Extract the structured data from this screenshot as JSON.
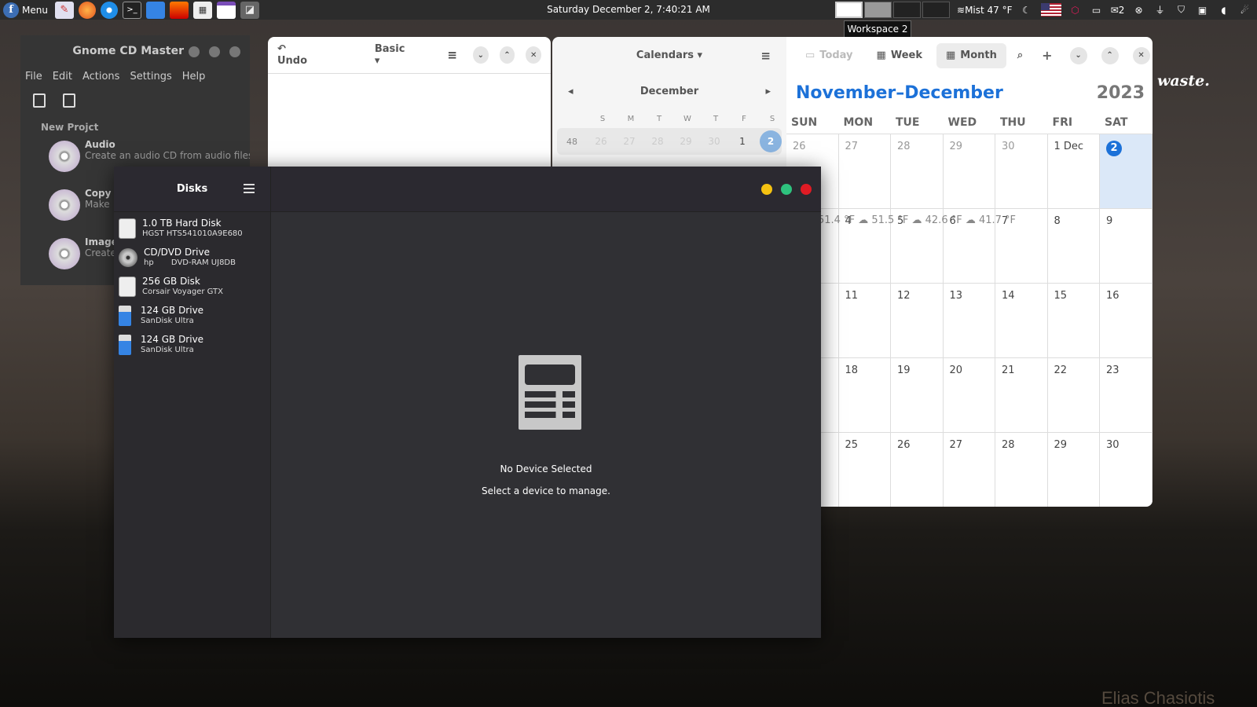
{
  "panel": {
    "menu_label": "Menu",
    "clock": "Saturday December  2,   7:40:21 AM",
    "weather": "Mist 47 °F",
    "notifications_count": "2",
    "workspace_tooltip": "Workspace 2",
    "launchers": [
      "text-editor-icon",
      "firefox-icon",
      "thunderbird-icon",
      "terminal-icon",
      "files-icon",
      "red-app-icon",
      "calculator-icon",
      "calendar-icon",
      "screenshot-icon"
    ]
  },
  "cdmaster": {
    "title": "Gnome CD Master",
    "menu": [
      "File",
      "Edit",
      "Actions",
      "Settings",
      "Help"
    ],
    "section": "New Projct",
    "items": [
      {
        "name": "Audio",
        "desc": "Create an audio CD from audio files"
      },
      {
        "name": "Copy",
        "desc": "Make"
      },
      {
        "name": "Image",
        "desc": "Create"
      }
    ]
  },
  "calculator": {
    "undo_label": "Undo",
    "mode_label": "Basic"
  },
  "calendar_sidebar": {
    "calendars_label": "Calendars",
    "month": "December",
    "dows": [
      "S",
      "M",
      "T",
      "W",
      "T",
      "F",
      "S"
    ],
    "week_number": "48",
    "week_days": [
      "26",
      "27",
      "28",
      "29",
      "30",
      "1",
      "2"
    ]
  },
  "calendar_main": {
    "today_label": "Today",
    "week_label": "Week",
    "month_label": "Month",
    "range_title": "November–December",
    "year": "2023",
    "dows": [
      "SUN",
      "MON",
      "TUE",
      "WED",
      "THU",
      "FRI",
      "SAT"
    ],
    "weeks": [
      [
        "26",
        "27",
        "28",
        "29",
        "30",
        "1  Dec",
        "2"
      ],
      [
        "",
        "4",
        "5",
        "6",
        "7",
        "8",
        "9"
      ],
      [
        "",
        "11",
        "12",
        "13",
        "14",
        "15",
        "16"
      ],
      [
        "",
        "18",
        "19",
        "20",
        "21",
        "22",
        "23"
      ],
      [
        "",
        "25",
        "26",
        "27",
        "28",
        "29",
        "30"
      ]
    ],
    "weather_strip": "51.4 °F ☁  51.5 °F ☁  42.6 °F ☁  41.7 °F"
  },
  "disks": {
    "title": "Disks",
    "drives": [
      {
        "name": "1.0 TB Hard Disk",
        "model": "HGST HTS541010A9E680",
        "type": "hdd"
      },
      {
        "name": "CD/DVD Drive",
        "model": "hp       DVD-RAM UJ8DB",
        "type": "cd"
      },
      {
        "name": "256 GB Disk",
        "model": "Corsair Voyager GTX",
        "type": "hdd"
      },
      {
        "name": "124 GB Drive",
        "model": "SanDisk Ultra",
        "type": "usb"
      },
      {
        "name": "124 GB Drive",
        "model": "SanDisk Ultra",
        "type": "usb"
      }
    ],
    "empty_title": "No Device Selected",
    "empty_subtitle": "Select a device to manage."
  },
  "background": {
    "quote_fragment": "waste.",
    "signature": "Elias Chasiotis"
  }
}
